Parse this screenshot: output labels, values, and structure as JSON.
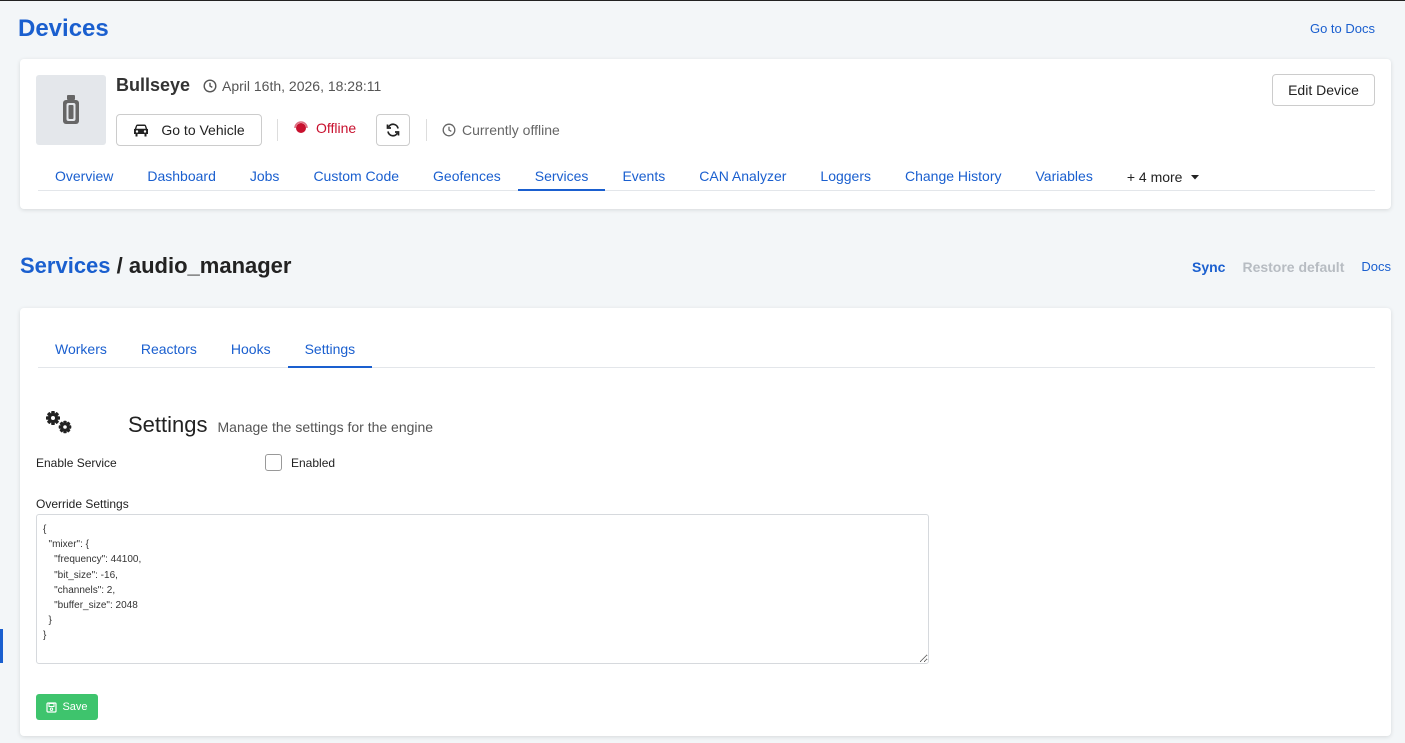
{
  "page": {
    "title": "Devices",
    "docs_link": "Go to Docs"
  },
  "device": {
    "name": "Bullseye",
    "timestamp": "April 16th, 2026, 18:28:11",
    "go_to_vehicle": "Go to Vehicle",
    "status": "Offline",
    "offline_note": "Currently offline",
    "edit_button": "Edit Device",
    "status_color": "#c8102e"
  },
  "device_tabs": [
    {
      "label": "Overview"
    },
    {
      "label": "Dashboard"
    },
    {
      "label": "Jobs"
    },
    {
      "label": "Custom Code"
    },
    {
      "label": "Geofences"
    },
    {
      "label": "Services"
    },
    {
      "label": "Events"
    },
    {
      "label": "CAN Analyzer"
    },
    {
      "label": "Loggers"
    },
    {
      "label": "Change History"
    },
    {
      "label": "Variables"
    }
  ],
  "device_tabs_more": "+ 4 more",
  "breadcrumb": {
    "parent": "Services",
    "separator": " / ",
    "current": "audio_manager"
  },
  "actions": {
    "sync": "Sync",
    "restore": "Restore default",
    "docs": "Docs"
  },
  "service_tabs": [
    {
      "label": "Workers"
    },
    {
      "label": "Reactors"
    },
    {
      "label": "Hooks"
    },
    {
      "label": "Settings"
    }
  ],
  "settings": {
    "title": "Settings",
    "subtitle": "Manage the settings for the engine",
    "enable_label": "Enable Service",
    "enabled_checkbox_label": "Enabled",
    "override_label": "Override Settings",
    "override_value": "{\n  \"mixer\": {\n    \"frequency\": 44100,\n    \"bit_size\": -16,\n    \"channels\": 2,\n    \"buffer_size\": 2048\n  }\n}",
    "save_label": "Save"
  },
  "colors": {
    "accent": "#1a5fcf",
    "save": "#3ec46d"
  }
}
